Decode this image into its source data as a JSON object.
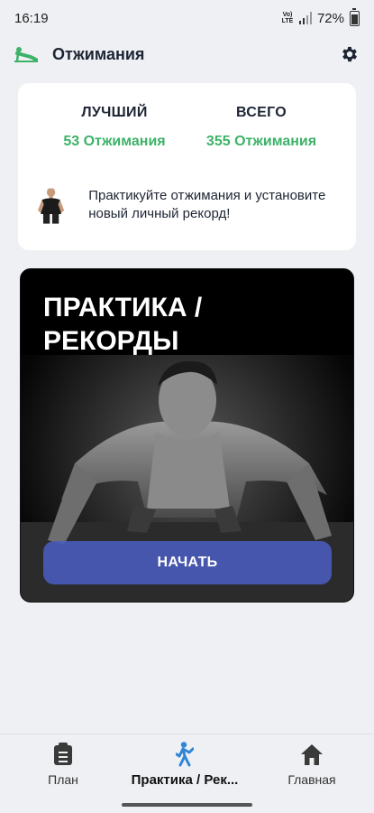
{
  "status_bar": {
    "time": "16:19",
    "volte": "Vo)\nLTE",
    "battery": "72%",
    "icons": [
      "volte-icon",
      "signal-icon",
      "battery-icon"
    ]
  },
  "app_bar": {
    "title": "Отжимания",
    "icons": [
      "pushup-logo-icon",
      "gear-icon"
    ],
    "accent": "#3db268"
  },
  "stats": {
    "best_label": "ЛУЧШИЙ",
    "best_value": "53 Отжимания",
    "total_label": "ВСЕГО",
    "total_value": "355 Отжимания",
    "promo_text": "Практикуйте отжимания и установите новый личный рекорд!",
    "value_color": "#3db268"
  },
  "hero": {
    "title_line1": "ПРАКТИКА /",
    "title_line2": "РЕКОРДЫ",
    "button_label": "НАЧАТЬ",
    "button_color": "#4a5cbe"
  },
  "bottom_nav": {
    "items": [
      {
        "label": "План",
        "icon": "clipboard-icon",
        "active": false
      },
      {
        "label": "Практика / Рек...",
        "icon": "exercise-person-icon",
        "active": true
      },
      {
        "label": "Главная",
        "icon": "home-icon",
        "active": false
      }
    ],
    "active_color": "#2f86d6"
  }
}
